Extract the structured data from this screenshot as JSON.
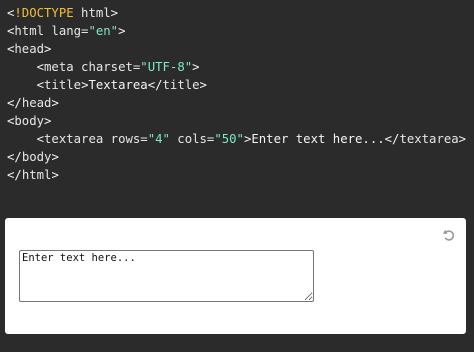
{
  "code": {
    "line1": {
      "open": "<",
      "doctype": "!DOCTYPE",
      "rest": " html",
      "close": ">"
    },
    "line2": {
      "open": "<",
      "tag": "html",
      "attr": " lang=",
      "value": "\"en\"",
      "close": ">"
    },
    "line3": {
      "open": "<",
      "tag": "head",
      "close": ">"
    },
    "line4": {
      "indent": "    ",
      "open": "<",
      "tag": "meta",
      "attr": " charset=",
      "value": "\"UTF-8\"",
      "close": ">"
    },
    "line5": {
      "indent": "    ",
      "open": "<",
      "tag": "title",
      "close": ">",
      "text": "Textarea",
      "end_open": "</",
      "end_tag": "title",
      "end_close": ">"
    },
    "line6": {
      "open": "</",
      "tag": "head",
      "close": ">"
    },
    "line7": {
      "open": "<",
      "tag": "body",
      "close": ">"
    },
    "line8": {
      "indent": "    ",
      "open": "<",
      "tag": "textarea",
      "attr1": " rows=",
      "value1": "\"4\"",
      "attr2": " cols=",
      "value2": "\"50\"",
      "close": ">",
      "text": "Enter text here...",
      "end_open": "</",
      "end_tag": "textarea",
      "end_close": ">"
    },
    "line9": {
      "open": "</",
      "tag": "body",
      "close": ">"
    },
    "line10": {
      "open": "</",
      "tag": "html",
      "close": ">"
    }
  },
  "output": {
    "textarea_value": "Enter text here...",
    "reset_icon": "reset-icon"
  },
  "colors": {
    "editor_background": "#2b2b2b",
    "doctype": "#f4bf3a",
    "string": "#7ee8c7",
    "output_background": "#ffffff"
  }
}
